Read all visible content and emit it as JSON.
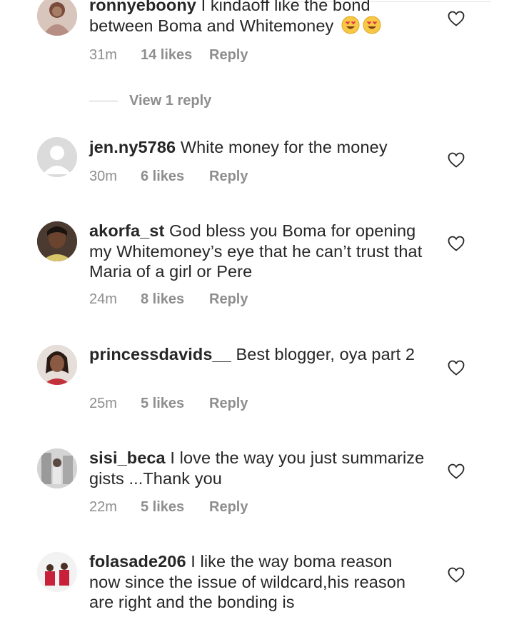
{
  "comments": [
    {
      "username": "ronnyeboony",
      "text": " I kindaoff like the bond between Boma and Whitemoney",
      "emojis": [
        "smiling-face-with-heart-eyes",
        "smiling-face-with-heart-eyes"
      ],
      "time": "31m",
      "likes": "14 likes",
      "reply": "Reply",
      "view_replies": "View 1 reply",
      "avatar": "user-photo-avatar"
    },
    {
      "username": "jen.ny5786",
      "text": " White money for the money",
      "time": "30m",
      "likes": "6 likes",
      "reply": "Reply",
      "avatar": "default-avatar"
    },
    {
      "username": "akorfa_st",
      "text": " God bless you Boma for opening my Whitemoney’s eye that he can’t trust that Maria of a girl or Pere",
      "time": "24m",
      "likes": "8 likes",
      "reply": "Reply",
      "avatar": "user-photo-avatar"
    },
    {
      "username": "princessdavids__",
      "text": " Best blogger, oya part 2",
      "time": "25m",
      "likes": "5 likes",
      "reply": "Reply",
      "avatar": "user-photo-avatar"
    },
    {
      "username": "sisi_beca",
      "text": " I love the way you just summarize gists ...Thank you",
      "time": "22m",
      "likes": "5 likes",
      "reply": "Reply",
      "avatar": "user-photo-avatar"
    },
    {
      "username": "folasade206",
      "text": " I like the way boma reason now since the issue of wildcard,his reason are right and the bonding is",
      "avatar": "user-photo-avatar"
    }
  ],
  "colors": {
    "text": "#262626",
    "meta": "#8e8e8e",
    "divider": "#c7c7c7"
  }
}
